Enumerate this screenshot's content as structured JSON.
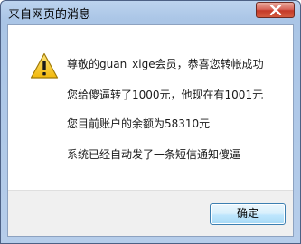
{
  "dialog": {
    "title": "来自网页的消息",
    "close_icon": "close-icon",
    "warning_icon": "warning-triangle-icon",
    "messages": [
      "尊敬的guan_xige会员，恭喜您转帐成功",
      "您给傻逼转了1000元，他现在有1001元",
      "您目前账户的余额为58310元",
      "系统已经自动发了一条短信通知傻逼"
    ],
    "ok_label": "确定"
  },
  "colors": {
    "title_bar": "#aac5e6",
    "close_button": "#c43a28",
    "warning_fill": "#f7c21a",
    "ok_button_border": "#3c7fb1"
  }
}
